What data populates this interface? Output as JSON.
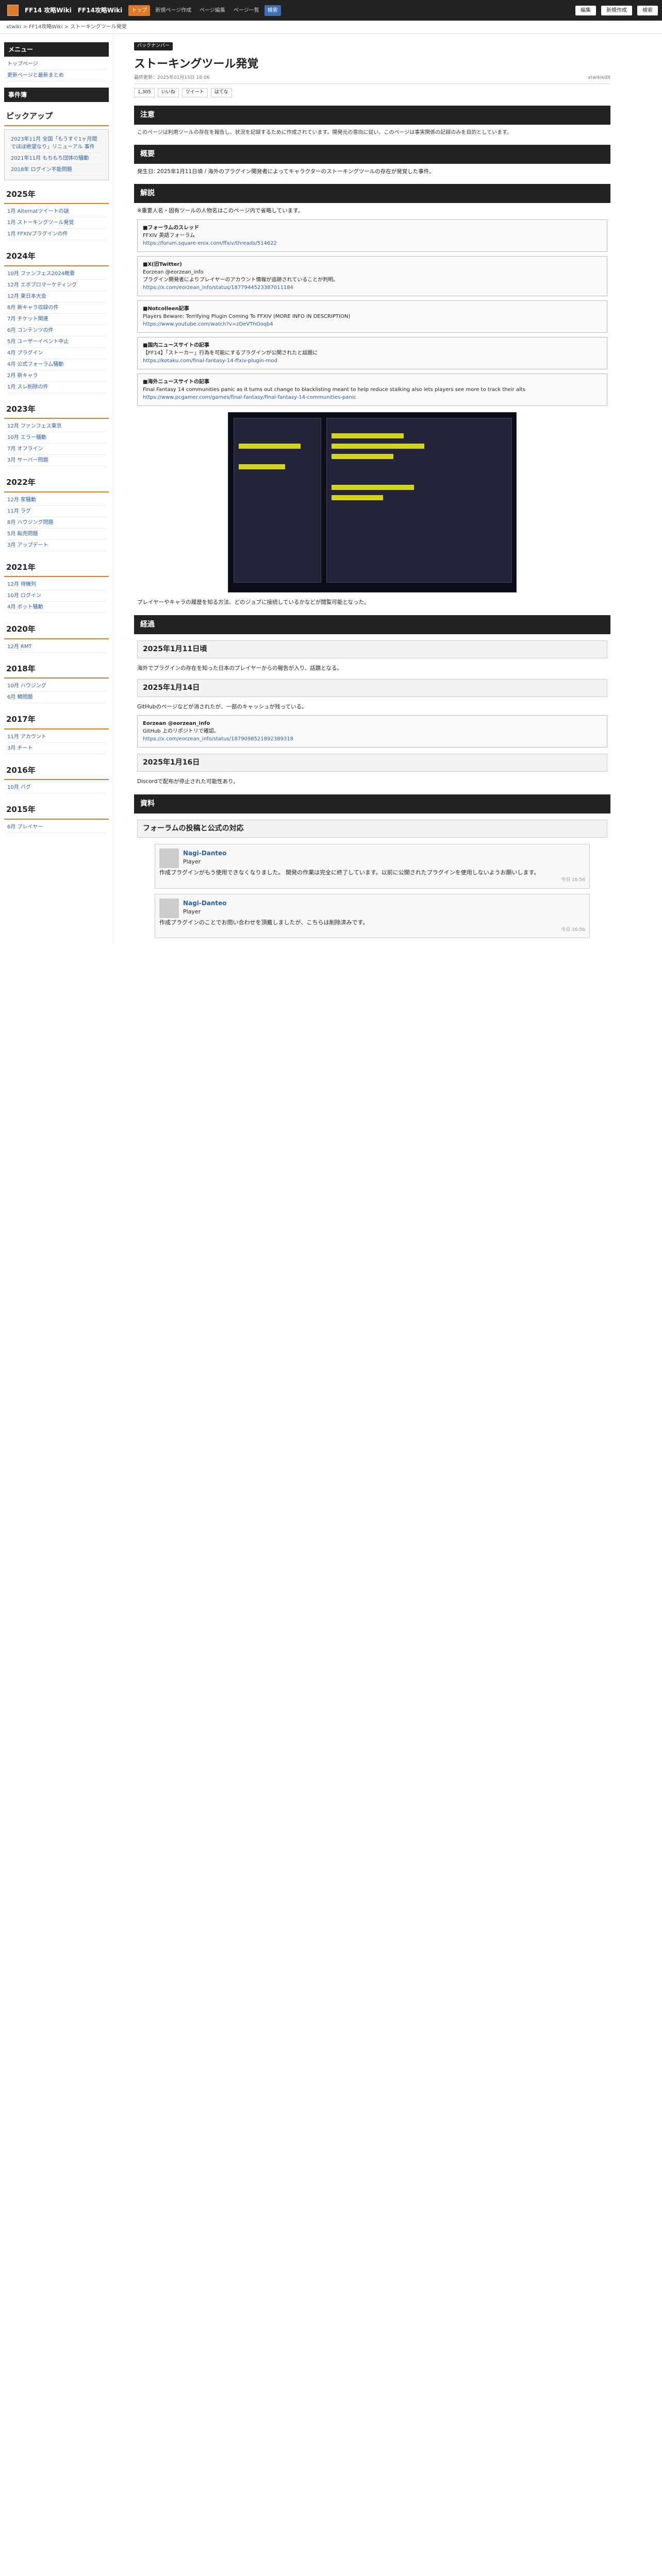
{
  "topbar": {
    "site": "FF14 攻略Wiki",
    "site2": "FF14攻略Wiki",
    "nav": [
      "トップ",
      "新規ページ作成",
      "ページ編集",
      "ページ一覧",
      "検索"
    ],
    "tools": [
      "編集",
      "新規作成",
      "検索"
    ]
  },
  "crumbs": "xtwiki > FF14攻略Wiki > ストーキングツール発覚",
  "sidebar": {
    "menu_title": "メニュー",
    "menu_items": [
      "トップページ",
      "更新ページと最新まとめ"
    ],
    "jiken_title": "事件簿",
    "pickup_title": "ピックアップ",
    "pickup": [
      "2023年11月 全国「もうすぐ1ヶ月間でほぼ絶望なり」リニューアル 事件",
      "2021年11月 もちもち団体の騒動",
      "2018年 ログイン不能問題"
    ],
    "y2025": "2025年",
    "list2025": [
      "1月 Alternatツイートの謎",
      "1月 ストーキングツール発覚",
      "1月 FFXIVプラグインの件"
    ],
    "y2024": "2024年",
    "list2024": [
      "10月 ファンフェス2024概要",
      "12月 エボブロマーケティング",
      "12月 東日本大会",
      "8月 新キャラ収録の件",
      "7月 チケット関連",
      "6月 コンテンツの件",
      "5月 ユーザーイベント中止",
      "4月 プラグイン",
      "4月 公式フォーラム騒動",
      "2月 新キャラ",
      "1月 スレ削除の件"
    ],
    "y2023": "2023年",
    "list2023": [
      "12月 ファンフェス東京",
      "10月 エラー騒動",
      "7月 オフライン",
      "3月 サーバー問題"
    ],
    "y2022": "2022年",
    "list2022": [
      "12月 家騒動",
      "11月 ラグ",
      "8月 ハウジング問題",
      "5月 転売問題",
      "3月 アップデート"
    ],
    "y2021": "2021年",
    "list2021": [
      "12月 待機列",
      "10月 ログイン",
      "4月 ボット騒動"
    ],
    "y2020": "2020年",
    "list2020": [
      "12月 RMT"
    ],
    "y2018": "2018年",
    "list2018": [
      "10月 ハウジング",
      "6月 鯖問題"
    ],
    "y2017": "2017年",
    "list2017": [
      "11月 アカウント",
      "3月 チート"
    ],
    "y2016": "2016年",
    "list2016": [
      "10月 バグ"
    ],
    "y2015": "2015年",
    "list2015": [
      "6月 プレイヤー"
    ]
  },
  "main": {
    "tag": "バックナンバー",
    "title": "ストーキングツール発覚",
    "updated": "最終更新：2025年01月15日 18:06",
    "author": "xtwikiedit",
    "likes": "1,305",
    "like_btns": [
      "いいね",
      "ツイート",
      "はてな"
    ],
    "s_notice": "注意",
    "notice": "このページは利用ツールの存在を報告し、状況を記録するために作成されています。開発元の意向に従い、このページは事実関係の記録のみを目的としています。",
    "s_summary": "概要",
    "summary": "発生日: 2025年1月11日頃 / 海外のプラグイン開発者によってキャラクターのストーキングツールの存在が発覚した事件。",
    "s_detail": "解説",
    "detail_intro": "※重要人名・固有ツールの人物名はこのページ内で省略しています。",
    "box1_title": "■フォーラムのスレッド",
    "box1_line": "FFXIV 英語フォーラム",
    "box1_url": "https://forum.square-enix.com/ffxiv/threads/514622",
    "box2_title": "■X(旧Twitter)",
    "box2_line": "Eorzean @eorzean_info",
    "box2_text": "プラグイン開発者によりプレイヤーのアカウント情報が追跡されていることが判明。",
    "box2_url": "https://x.com/eorzean_info/status/1877944523387011184",
    "box3_title": "■Notcolleen記事",
    "box3_line": "Players Beware: Terrifying Plugin Coming To FFXIV (MORE INFO IN DESCRIPTION)",
    "box3_url": "https://www.youtube.com/watch?v=zDeVThOoqb4",
    "box4_title": "■国内ニュースサイトの記事",
    "box4_text": "【FF14】「ストーカー」行為を可能にするプラグインが公開されたと話題に",
    "box4_url": "https://kotaku.com/final-fantasy-14-ffxiv-plugin-mod",
    "box5_title": "■海外ニュースサイトの記事",
    "box5_text": "Final Fantasy 14 communities panic as it turns out change to blacklisting meant to help reduce stalking also lets players see more to track their alts",
    "box5_url": "https://www.pcgamer.com/games/final-fantasy/final-fantasy-14-communities-panic",
    "after_shot": "プレイヤーやキャラの履歴を知る方法、どのジョブに接続しているかなどが閲覧可能となった。",
    "s_progress": "経過",
    "d1": "2025年1月11日頃",
    "d1_text": "海外でプラグインの存在を知った日本のプレイヤーからの報告が入り、話題となる。",
    "d2": "2025年1月14日",
    "d2_text": "GitHubのページなどが消されたが、一部のキャッシュが残っている。",
    "d2_box_name": "Eorzean @eorzean_info",
    "d2_box_text": "GitHub 上のリポジトリで確認。",
    "d2_box_url": "https://x.com/eorzean_info/status/1879098521892389318",
    "d3": "2025年1月16日",
    "d3_text": "Discordで配布が停止された可能性あり。",
    "s_res": "資料",
    "res_sub": "フォーラムの投稿と公式の対応",
    "f1_name": "Nagi-Danteo",
    "f1_role": "Player",
    "f1_text": "作成プラグインがもう使用できなくなりました。 開発の作業は完全に終了しています。以前に公開されたプラグインを使用しないようお願いします。",
    "f1_ts": "今日 16:56",
    "f2_name": "Nagi-Danteo",
    "f2_role": "Player",
    "f2_text": "作成プラグインのことでお問い合わせを頂戴しましたが、こちらは削除済みです。",
    "f2_ts": "今日 16:56"
  }
}
